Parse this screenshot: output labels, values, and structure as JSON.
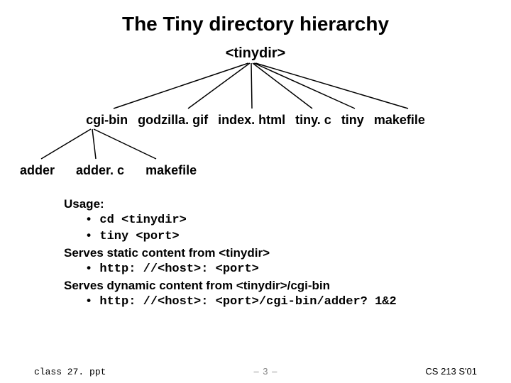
{
  "title": "The Tiny directory hierarchy",
  "tree": {
    "root": "<tinydir>",
    "level1": {
      "n0": "cgi-bin",
      "n1": "godzilla. gif",
      "n2": "index. html",
      "n3": "tiny. c",
      "n4": "tiny",
      "n5": "makefile"
    },
    "level2": {
      "n0": "adder",
      "n1": "adder. c",
      "n2": "makefile"
    }
  },
  "usage": {
    "heading": "Usage:",
    "line1": "cd <tinydir>",
    "line2": "tiny <port>",
    "static_heading": "Serves static content from <tinydir>",
    "static_line": "http: //<host>: <port>",
    "dynamic_heading": "Serves dynamic content from <tinydir>/cgi-bin",
    "dynamic_line": "http: //<host>: <port>/cgi-bin/adder? 1&2"
  },
  "footer": {
    "filename": "class 27. ppt",
    "page": "– 3 –",
    "course": "CS 213 S'01"
  }
}
